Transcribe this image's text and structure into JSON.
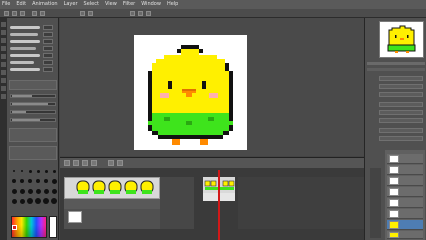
{
  "app": {
    "title": ""
  },
  "menubar": {
    "items": [
      "File",
      "Edit",
      "Animation",
      "Layer",
      "Select",
      "View",
      "Filter",
      "Window",
      "Help"
    ]
  },
  "colors": {
    "chick_body": "#fff000",
    "chick_outline": "#111111",
    "chick_skirt": "#3ee41c",
    "chick_beak": "#ff8a00",
    "chick_cheek": "#ffb0b0",
    "canvas_bg": "#ffffff",
    "playhead": "#d21818",
    "selected_layer": "#4e7db3"
  },
  "icons": {
    "canvas_art": "pixel-chick-sprite",
    "navigator_preview": "pixel-chick-thumbnail",
    "timeline_frames": "pixel-chick-frames",
    "color_picker": "color-wheel-icon"
  },
  "timeline": {
    "frame_count": 5
  },
  "layers": {
    "count": 8,
    "selected_index": 6
  }
}
